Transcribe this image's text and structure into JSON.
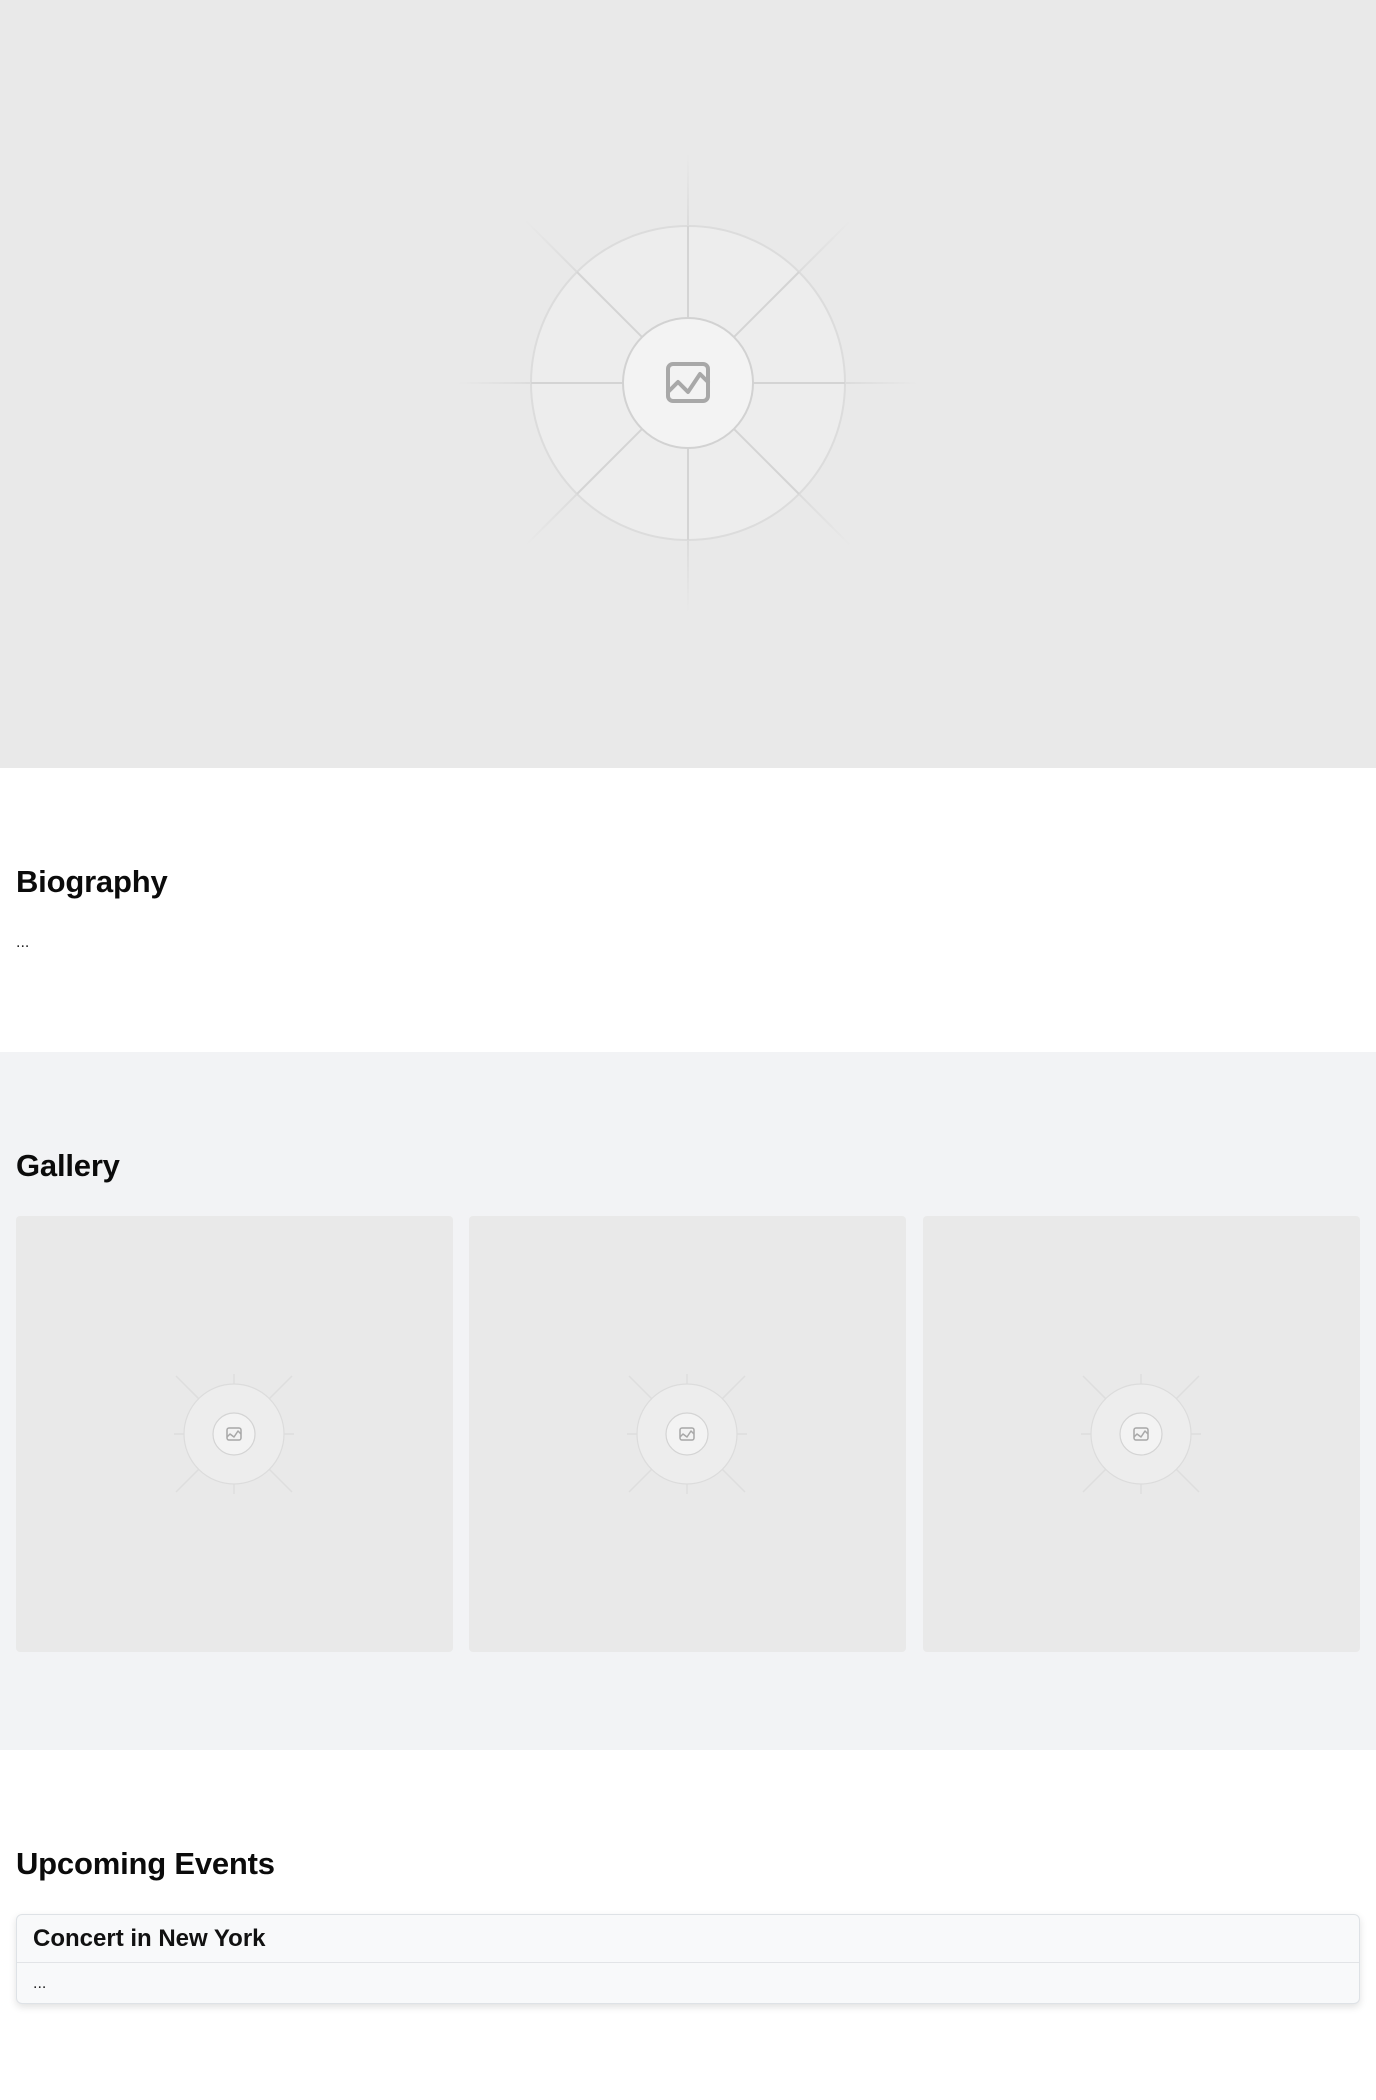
{
  "hero": {
    "image_icon": "image-icon"
  },
  "biography": {
    "title": "Biography",
    "text": "..."
  },
  "gallery": {
    "title": "Gallery",
    "items": [
      {
        "image_icon": "image-icon"
      },
      {
        "image_icon": "image-icon"
      },
      {
        "image_icon": "image-icon"
      }
    ]
  },
  "events": {
    "title": "Upcoming Events",
    "items": [
      {
        "title": "Concert in New York",
        "body": "..."
      }
    ]
  },
  "colors": {
    "placeholder_bg": "#e9e9e9",
    "gallery_bg": "#f2f3f5",
    "card_bg": "#f8f9fa",
    "card_border": "#dee2e6",
    "heading": "#0b0b0b"
  }
}
